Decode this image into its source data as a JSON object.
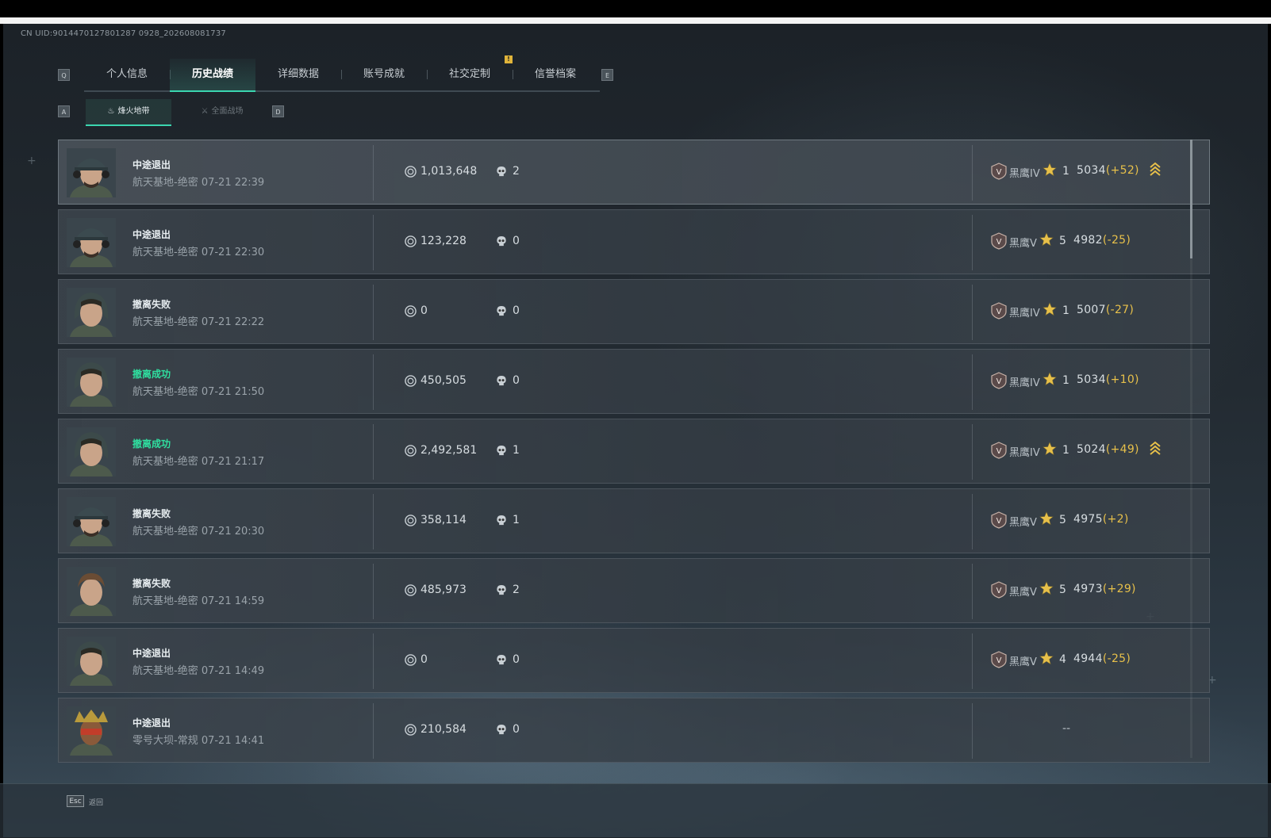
{
  "uid_text": "CN UID:9014470127801287 0928_202608081737",
  "tabs_keys": {
    "left": "Q",
    "right": "E"
  },
  "tabs": [
    {
      "label": "个人信息",
      "active": false
    },
    {
      "label": "历史战绩",
      "active": true
    },
    {
      "label": "详细数据",
      "active": false
    },
    {
      "label": "账号成就",
      "active": false
    },
    {
      "label": "社交定制",
      "active": false
    },
    {
      "label": "信誉档案",
      "active": false
    }
  ],
  "notification_badge": "!",
  "subtabs_keys": {
    "left": "A",
    "right": "D"
  },
  "subtabs": [
    {
      "label": "烽火地带",
      "active": true
    },
    {
      "label": "全面战场",
      "active": false
    }
  ],
  "rows": [
    {
      "result": "中途退出",
      "success": false,
      "map_time": "航天基地-绝密 07-21 22:39",
      "coins": "1,013,648",
      "kills": "2",
      "rank": "黑鹰IV",
      "stars": "1",
      "score": "5034",
      "delta": "(+52)",
      "promo": true,
      "avatar": "cap"
    },
    {
      "result": "中途退出",
      "success": false,
      "map_time": "航天基地-绝密 07-21 22:30",
      "coins": "123,228",
      "kills": "0",
      "rank": "黑鹰V",
      "stars": "5",
      "score": "4982",
      "delta": "(-25)",
      "promo": false,
      "avatar": "cap"
    },
    {
      "result": "撤离失败",
      "success": false,
      "map_time": "航天基地-绝密 07-21 22:22",
      "coins": "0",
      "kills": "0",
      "rank": "黑鹰IV",
      "stars": "1",
      "score": "5007",
      "delta": "(-27)",
      "promo": false,
      "avatar": "hood"
    },
    {
      "result": "撤离成功",
      "success": true,
      "map_time": "航天基地-绝密 07-21 21:50",
      "coins": "450,505",
      "kills": "0",
      "rank": "黑鹰IV",
      "stars": "1",
      "score": "5034",
      "delta": "(+10)",
      "promo": false,
      "avatar": "hood"
    },
    {
      "result": "撤离成功",
      "success": true,
      "map_time": "航天基地-绝密 07-21 21:17",
      "coins": "2,492,581",
      "kills": "1",
      "rank": "黑鹰IV",
      "stars": "1",
      "score": "5024",
      "delta": "(+49)",
      "promo": true,
      "avatar": "hood"
    },
    {
      "result": "撤离失败",
      "success": false,
      "map_time": "航天基地-绝密 07-21 20:30",
      "coins": "358,114",
      "kills": "1",
      "rank": "黑鹰V",
      "stars": "5",
      "score": "4975",
      "delta": "(+2)",
      "promo": false,
      "avatar": "cap"
    },
    {
      "result": "撤离失败",
      "success": false,
      "map_time": "航天基地-绝密 07-21 14:59",
      "coins": "485,973",
      "kills": "2",
      "rank": "黑鹰V",
      "stars": "5",
      "score": "4973",
      "delta": "(+29)",
      "promo": false,
      "avatar": "hair"
    },
    {
      "result": "中途退出",
      "success": false,
      "map_time": "航天基地-绝密 07-21 14:49",
      "coins": "0",
      "kills": "0",
      "rank": "黑鹰V",
      "stars": "4",
      "score": "4944",
      "delta": "(-25)",
      "promo": false,
      "avatar": "hood"
    },
    {
      "result": "中途退出",
      "success": false,
      "map_time": "零号大坝-常规 07-21 14:41",
      "coins": "210,584",
      "kills": "0",
      "rank": "",
      "stars": "",
      "score": "",
      "delta": "",
      "promo": false,
      "avatar": "mask",
      "no_rank_text": "--"
    }
  ],
  "footer": {
    "esc_key": "Esc",
    "esc_label": "返回"
  },
  "colors": {
    "accent": "#3bd6b0",
    "success": "#2fe0a0",
    "delta": "#e7c04a",
    "star": "#e7c04a"
  }
}
